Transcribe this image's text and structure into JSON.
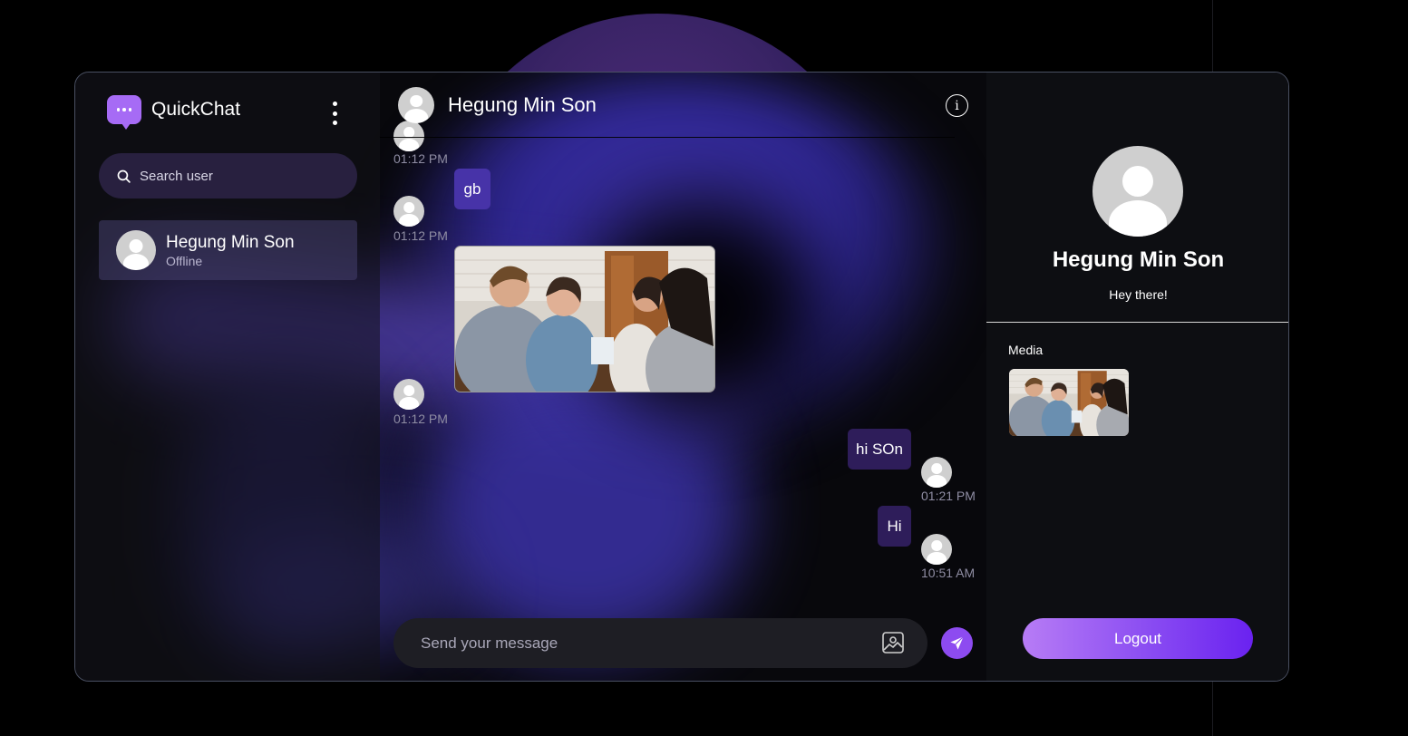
{
  "app": {
    "name": "QuickChat"
  },
  "search": {
    "placeholder": "Search user"
  },
  "contacts": [
    {
      "name": "Hegung Min Son",
      "status": "Offline"
    }
  ],
  "chat": {
    "title": "Hegung Min Son",
    "messages": [
      {
        "side": "left",
        "type": "text",
        "text": "",
        "time": "01:12 PM"
      },
      {
        "side": "left",
        "type": "text",
        "text": "gb",
        "time": "01:12 PM"
      },
      {
        "side": "left",
        "type": "image",
        "alt": "friends-photo",
        "time": "01:12 PM"
      },
      {
        "side": "right",
        "type": "text",
        "text": "hi SOn",
        "time": "01:21 PM"
      },
      {
        "side": "right",
        "type": "text",
        "text": "Hi",
        "time": "10:51 AM"
      }
    ],
    "composer_placeholder": "Send your message"
  },
  "profile": {
    "name": "Hegung Min Son",
    "bio": "Hey there!",
    "media_label": "Media",
    "logout_label": "Logout"
  },
  "colors": {
    "accent": "#8d4bf0",
    "logo": "#a66bf5",
    "bubble_received": "#4733a8",
    "bubble_sent": "#2e1d5a"
  },
  "icons": {
    "logo": "chat-bubble-icon",
    "menu": "kebab-menu-icon",
    "search": "search-icon",
    "info": "info-icon",
    "image": "image-upload-icon",
    "send": "send-icon"
  }
}
